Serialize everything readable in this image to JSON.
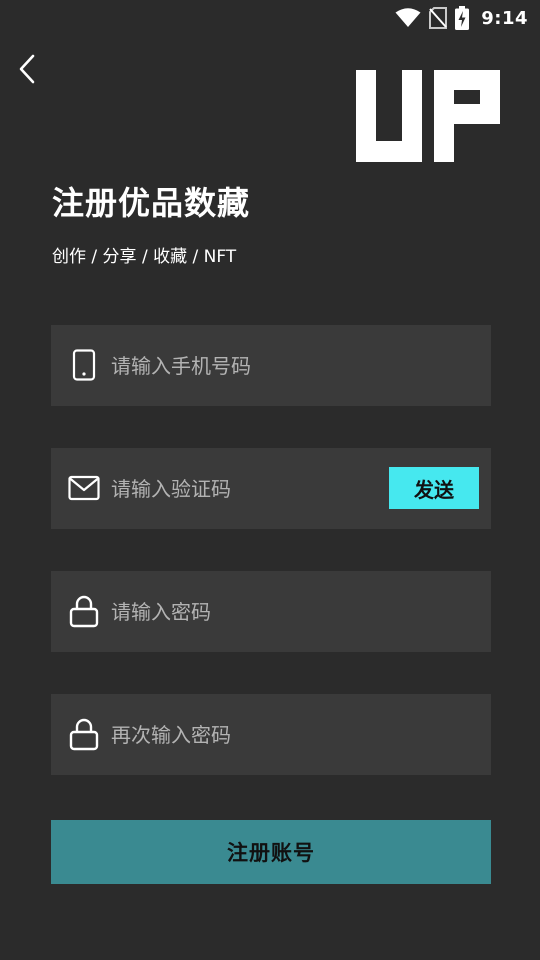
{
  "status_bar": {
    "time": "9:14",
    "icons": [
      "wifi-icon",
      "no-sim-icon",
      "battery-charging-icon"
    ]
  },
  "header": {
    "back_icon": "chevron-left-icon",
    "logo_text": "UP",
    "title": "注册优品数藏",
    "subtitle": "创作 / 分享 / 收藏 / NFT"
  },
  "form": {
    "phone": {
      "icon": "phone-icon",
      "placeholder": "请输入手机号码",
      "value": ""
    },
    "code": {
      "icon": "mail-icon",
      "placeholder": "请输入验证码",
      "value": "",
      "send_label": "发送"
    },
    "password": {
      "icon": "lock-icon",
      "placeholder": "请输入密码",
      "value": ""
    },
    "password_confirm": {
      "icon": "lock-icon",
      "placeholder": "再次输入密码",
      "value": ""
    },
    "submit_label": "注册账号"
  },
  "colors": {
    "background": "#2b2b2b",
    "field_background": "#3a3a3a",
    "send_button": "#46e8ef",
    "register_button": "#3a8a91"
  }
}
